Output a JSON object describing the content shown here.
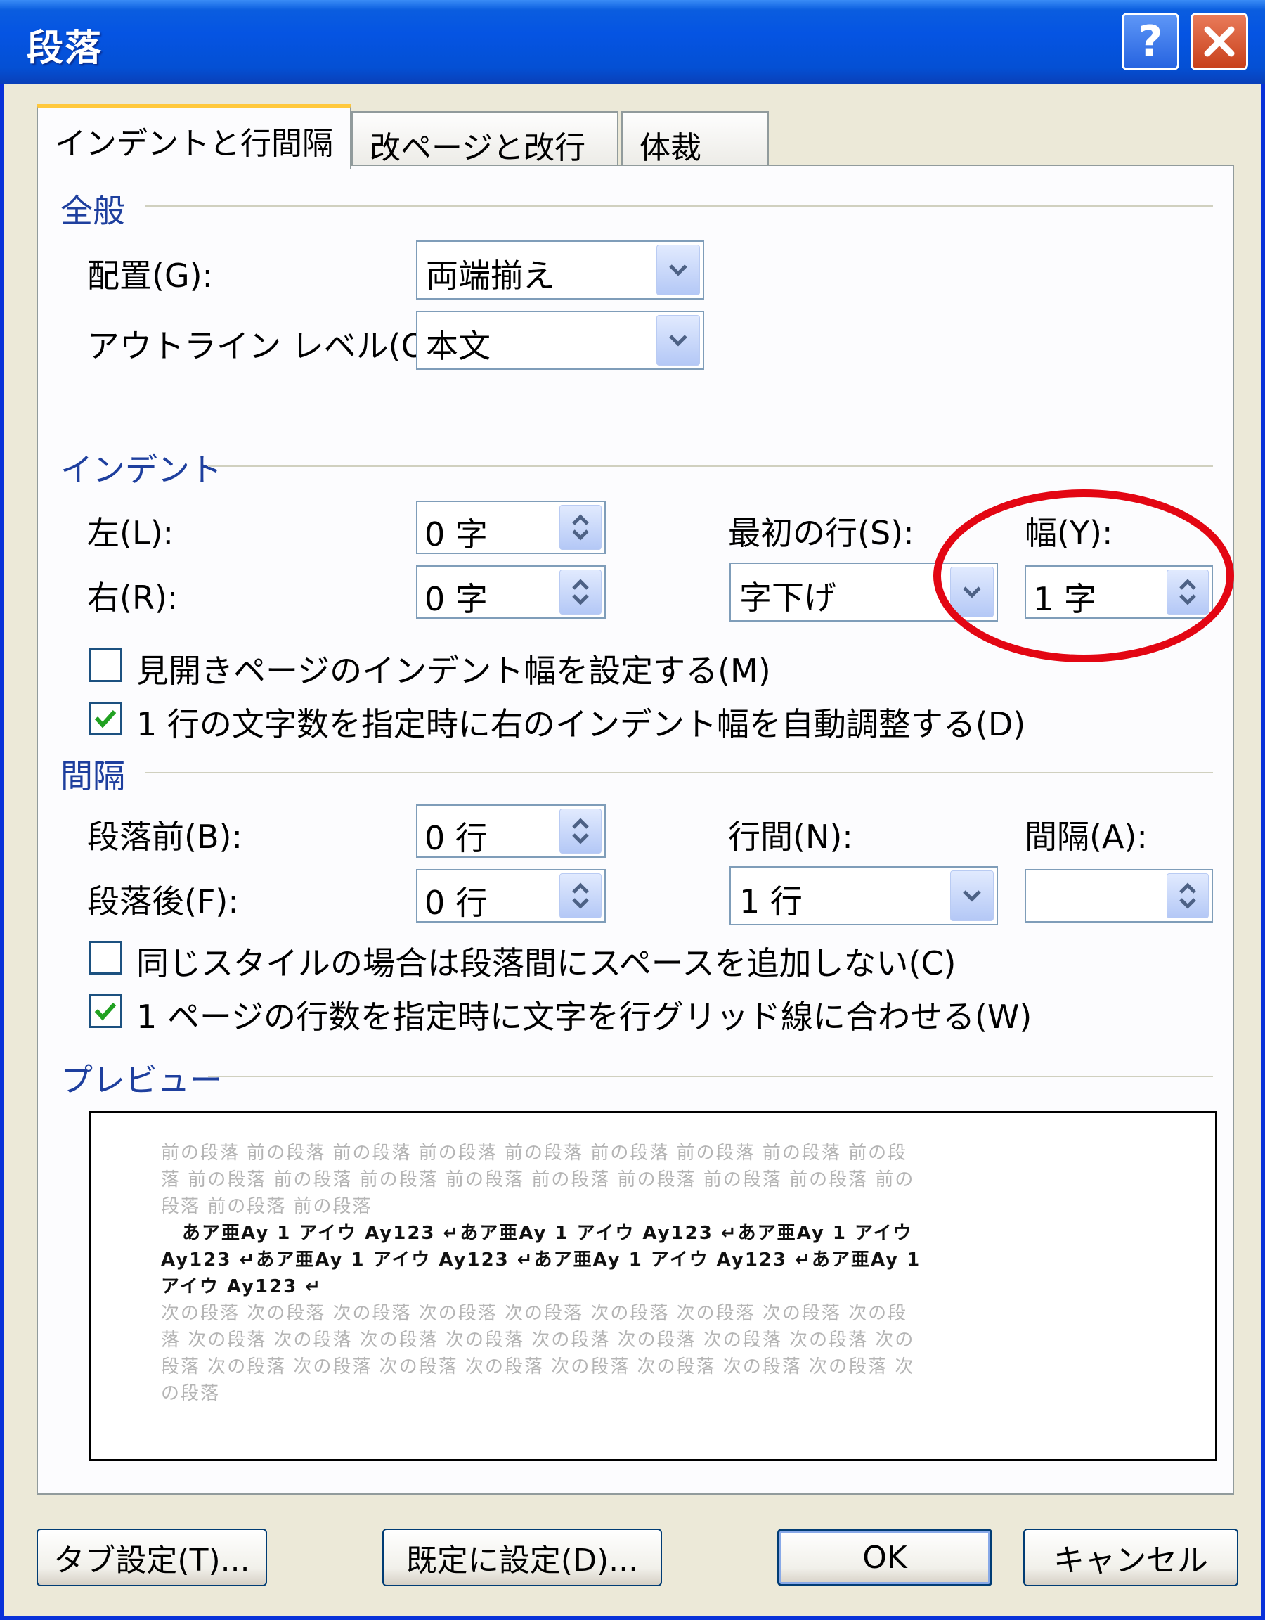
{
  "window": {
    "title": "段落"
  },
  "title_buttons": {
    "help": "?"
  },
  "tabs": [
    {
      "label": "インデントと行間隔",
      "active": true
    },
    {
      "label": "改ページと改行",
      "active": false
    },
    {
      "label": "体裁",
      "active": false
    }
  ],
  "general": {
    "heading": "全般",
    "alignment_label": "配置(G):",
    "alignment_value": "両端揃え",
    "outline_label": "アウトライン レベル(O):",
    "outline_value": "本文"
  },
  "indent": {
    "heading": "インデント",
    "left_label": "左(L):",
    "left_value": "0 字",
    "right_label": "右(R):",
    "right_value": "0 字",
    "first_line_label": "最初の行(S):",
    "first_line_value": "字下げ",
    "width_label": "幅(Y):",
    "width_value": "1 字",
    "mirror_label": "見開きページのインデント幅を設定する(M)",
    "mirror_checked": false,
    "auto_adjust_label": "1 行の文字数を指定時に右のインデント幅を自動調整する(D)",
    "auto_adjust_checked": true
  },
  "spacing": {
    "heading": "間隔",
    "before_label": "段落前(B):",
    "before_value": "0 行",
    "after_label": "段落後(F):",
    "after_value": "0 行",
    "line_spacing_label": "行間(N):",
    "line_spacing_value": "1 行",
    "at_label": "間隔(A):",
    "at_value": "",
    "no_space_label": "同じスタイルの場合は段落間にスペースを追加しない(C)",
    "no_space_checked": false,
    "grid_label": "1 ページの行数を指定時に文字を行グリッド線に合わせる(W)",
    "grid_checked": true
  },
  "preview": {
    "heading": "プレビュー",
    "lines": [
      {
        "text": "前の段落 前の段落 前の段落 前の段落 前の段落 前の段落 前の段落 前の段落 前の段",
        "style": "gray"
      },
      {
        "text": "落 前の段落 前の段落 前の段落 前の段落 前の段落 前の段落 前の段落 前の段落 前の",
        "style": "gray"
      },
      {
        "text": "段落 前の段落 前の段落",
        "style": "gray"
      },
      {
        "text": "  あア亜Ay 1 アイウ Ay123 ↵あア亜Ay 1 アイウ Ay123 ↵あア亜Ay 1 アイウ",
        "style": "black"
      },
      {
        "text": "Ay123 ↵あア亜Ay 1 アイウ Ay123 ↵あア亜Ay 1 アイウ Ay123 ↵あア亜Ay 1",
        "style": "black"
      },
      {
        "text": "アイウ Ay123 ↵",
        "style": "black"
      },
      {
        "text": "次の段落 次の段落 次の段落 次の段落 次の段落 次の段落 次の段落 次の段落 次の段",
        "style": "gray"
      },
      {
        "text": "落 次の段落 次の段落 次の段落 次の段落 次の段落 次の段落 次の段落 次の段落 次の",
        "style": "gray"
      },
      {
        "text": "段落 次の段落 次の段落 次の段落 次の段落 次の段落 次の段落 次の段落 次の段落 次",
        "style": "gray"
      },
      {
        "text": "の段落",
        "style": "gray"
      }
    ]
  },
  "buttons": {
    "tabs": "タブ設定(T)...",
    "default": "既定に設定(D)...",
    "ok": "OK",
    "cancel": "キャンセル"
  },
  "colors": {
    "title_bar": "#0554e3",
    "section_heading": "#1e3f9e",
    "annotation_circle": "#e30613"
  }
}
